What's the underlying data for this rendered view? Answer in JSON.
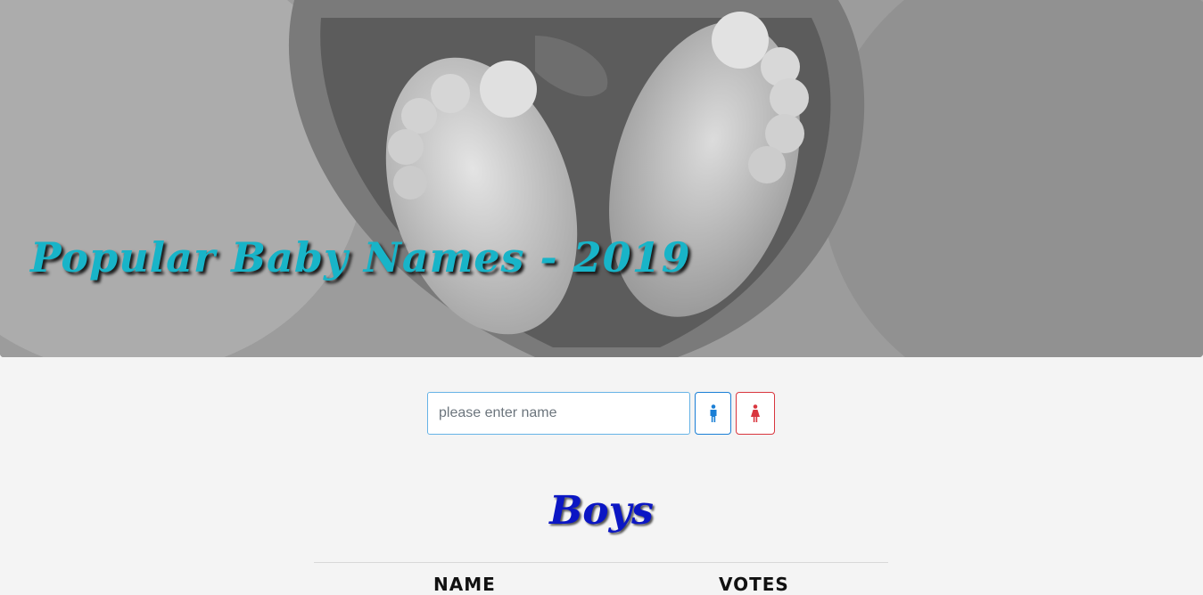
{
  "hero": {
    "title": "Popular Baby Names - 2019"
  },
  "search": {
    "placeholder": "please enter name",
    "value": "",
    "boy_button_icon": "male-icon",
    "girl_button_icon": "female-icon"
  },
  "section": {
    "title": "Boys",
    "columns": [
      "NAME",
      "VOTES"
    ]
  },
  "colors": {
    "hero_title": "#18b4c8",
    "section_title": "#0b16c4",
    "boy_accent": "#1a7fd6",
    "girl_accent": "#d9363e",
    "background": "#f4f4f4"
  }
}
